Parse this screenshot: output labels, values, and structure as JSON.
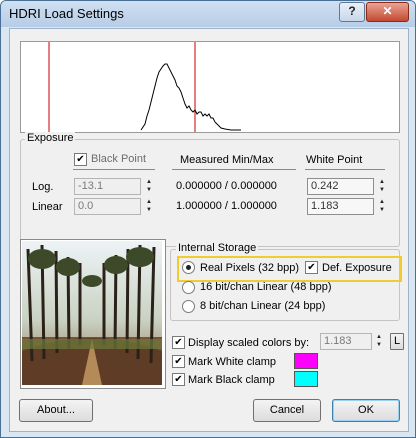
{
  "window": {
    "title": "HDRI Load Settings",
    "help_label": "?",
    "close_label": "✕"
  },
  "exposure": {
    "group_label": "Exposure",
    "black_point_label": "Black Point",
    "black_point_checked": true,
    "measured_label": "Measured Min/Max",
    "white_point_label": "White Point",
    "log_label": "Log.",
    "linear_label": "Linear",
    "black_log": "-13.1",
    "black_linear": "0.0",
    "measured_log": "0.000000 / 0.000000",
    "measured_linear": "1.000000 / 1.000000",
    "white_log": "0.242",
    "white_linear": "1.183"
  },
  "storage": {
    "group_label": "Internal Storage",
    "real_pixels": "Real Pixels (32 bpp)",
    "def_exposure": "Def. Exposure",
    "def_exposure_checked": true,
    "bit16": "16 bit/chan Linear (48 bpp)",
    "bit8": "8 bit/chan Linear (24 bpp)",
    "selected": "real_pixels"
  },
  "display": {
    "scaled_label": "Display scaled colors by:",
    "scaled_checked": true,
    "scaled_value": "1.183",
    "l_button": "L",
    "white_clamp_label": "Mark White clamp",
    "white_clamp_checked": true,
    "white_clamp_color": "#ff00ff",
    "black_clamp_label": "Mark Black clamp",
    "black_clamp_checked": true,
    "black_clamp_color": "#00ffff"
  },
  "buttons": {
    "about": "About...",
    "cancel": "Cancel",
    "ok": "OK"
  },
  "histogram": {
    "marker_color": "#cc0000"
  }
}
